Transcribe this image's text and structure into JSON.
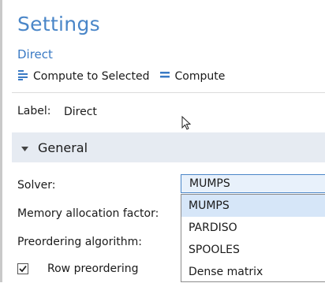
{
  "header": {
    "title": "Settings",
    "subtitle": "Direct"
  },
  "toolbar": {
    "compute_selected_label": "Compute to Selected",
    "compute_label": "Compute"
  },
  "label_field": {
    "label": "Label:",
    "value": "Direct"
  },
  "section": {
    "title": "General"
  },
  "properties": {
    "solver_label": "Solver:",
    "memory_label": "Memory allocation factor:",
    "preordering_label": "Preordering algorithm:"
  },
  "solver_select": {
    "selected": "MUMPS",
    "options": [
      "MUMPS",
      "PARDISO",
      "SPOOLES",
      "Dense matrix"
    ]
  },
  "row_preordering": {
    "label": "Row preordering",
    "checked": true
  },
  "colors": {
    "accent": "#4a86c8",
    "section_bg": "#e6ebf2",
    "selected_bg": "#d6e6f8"
  },
  "icons": [
    "compute-to-selected-icon",
    "compute-icon",
    "collapse-arrow-icon",
    "checkmark-icon",
    "mouse-cursor-icon"
  ]
}
